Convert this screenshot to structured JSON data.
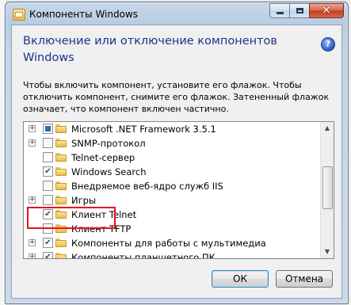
{
  "window": {
    "title": "Компоненты Windows",
    "heading": "Включение или отключение компонентов Windows",
    "help_glyph": "?",
    "description": "Чтобы включить компонент, установите его флажок. Чтобы отключить компонент, снимите его флажок. Затененный флажок означает, что компонент включен частично."
  },
  "caption_buttons": {
    "minimize_icon": "minimize-icon",
    "maximize_icon": "maximize-icon",
    "close_glyph": "✕"
  },
  "features": [
    {
      "label": "Microsoft .NET Framework 3.5.1",
      "state": "partial",
      "expandable": true
    },
    {
      "label": "SNMP-протокол",
      "state": "unchecked",
      "expandable": true
    },
    {
      "label": "Telnet-сервер",
      "state": "unchecked",
      "expandable": false
    },
    {
      "label": "Windows Search",
      "state": "checked",
      "expandable": false
    },
    {
      "label": "Внедряемое веб-ядро служб IIS",
      "state": "unchecked",
      "expandable": false
    },
    {
      "label": "Игры",
      "state": "unchecked",
      "expandable": true,
      "highlighted": true
    },
    {
      "label": "Клиент Telnet",
      "state": "checked",
      "expandable": false
    },
    {
      "label": "Клиент TFTP",
      "state": "unchecked",
      "expandable": false
    },
    {
      "label": "Компоненты для работы с мультимедиа",
      "state": "checked",
      "expandable": true
    },
    {
      "label": "Компоненты планшетного ПК",
      "state": "checked",
      "expandable": true
    }
  ],
  "buttons": {
    "ok": "ОК",
    "cancel": "Отмена"
  },
  "colors": {
    "heading": "#1e3287",
    "highlight_box": "#e8131a"
  }
}
